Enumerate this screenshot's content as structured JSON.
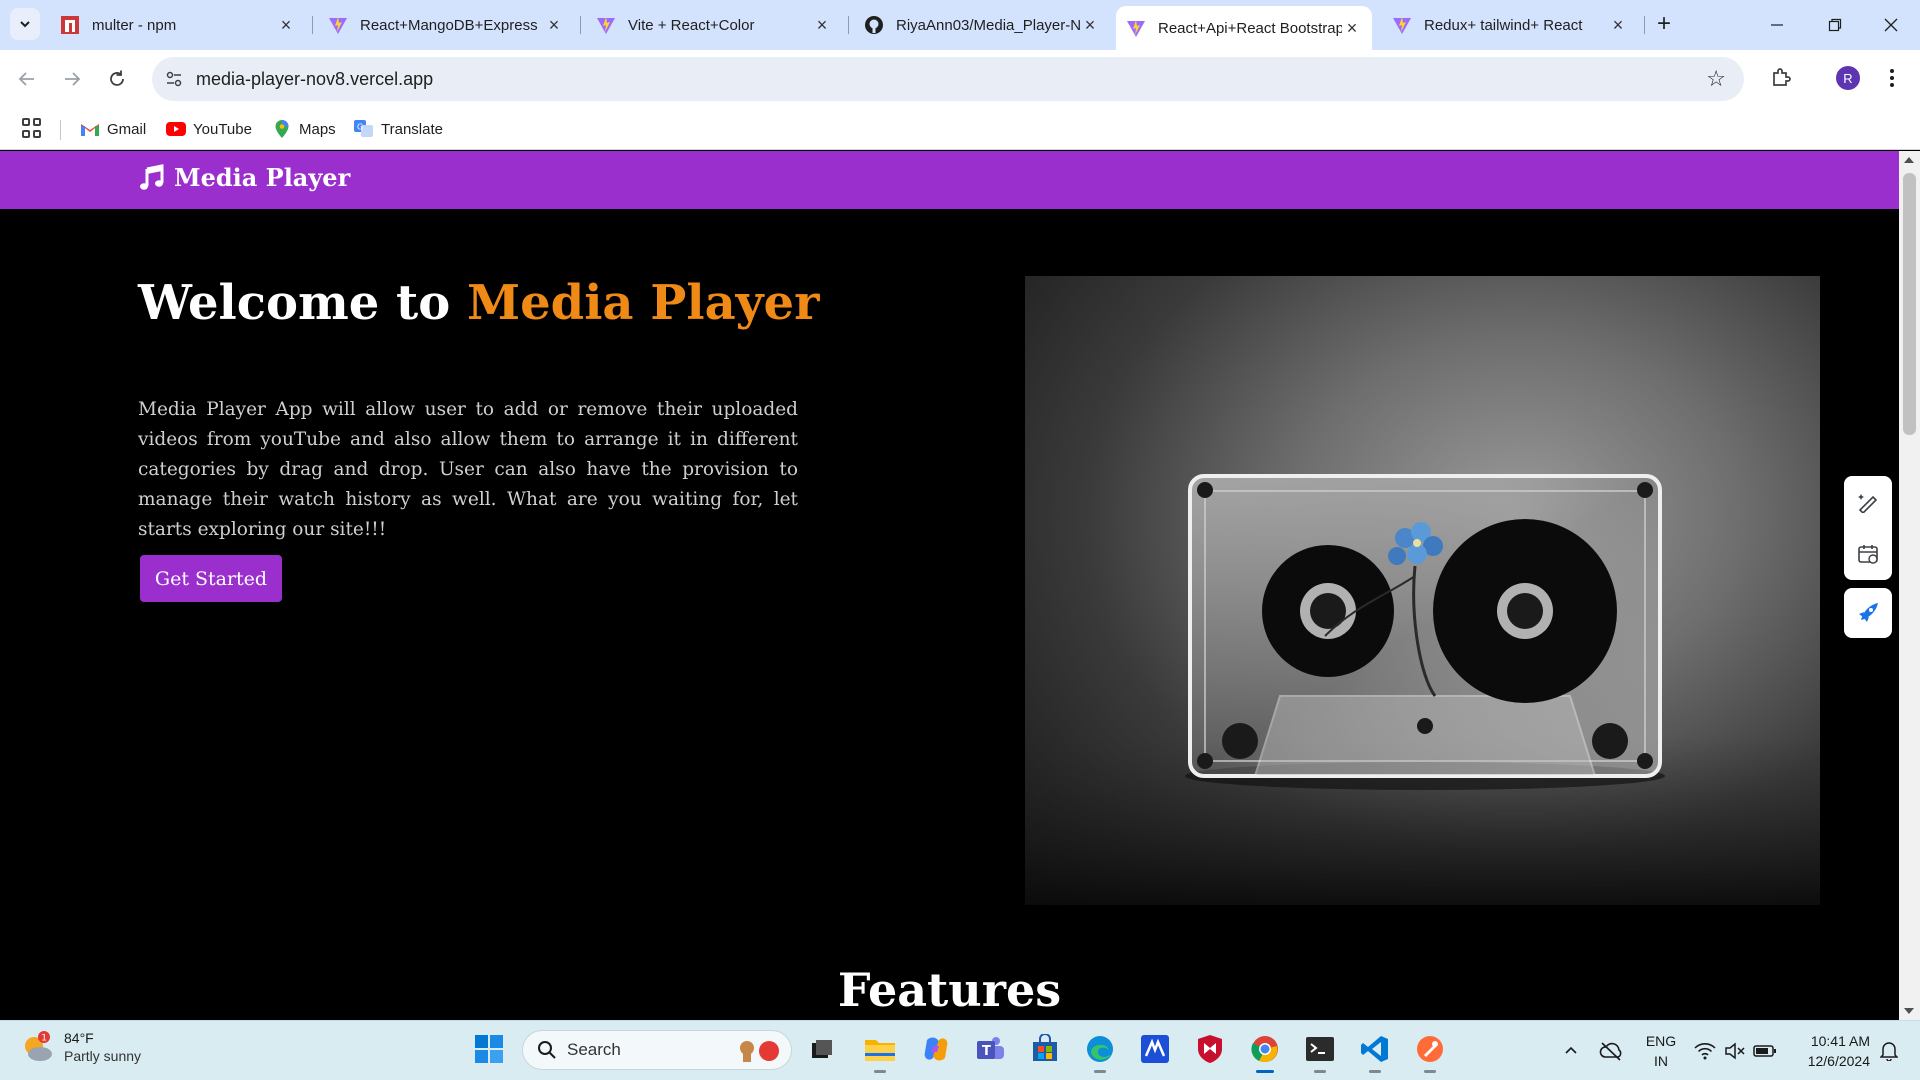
{
  "browser": {
    "tabs": [
      {
        "title": "multer - npm",
        "icon": "npm-icon",
        "active": false
      },
      {
        "title": "React+MangoDB+Express",
        "icon": "vite-icon",
        "active": false
      },
      {
        "title": "Vite + React+Color",
        "icon": "vite-icon",
        "active": false
      },
      {
        "title": "RiyaAnn03/Media_Player-N",
        "icon": "github-icon",
        "active": false
      },
      {
        "title": "React+Api+React Bootstrap",
        "icon": "vite-icon",
        "active": true
      },
      {
        "title": "Redux+ tailwind+ React",
        "icon": "vite-icon",
        "active": false
      }
    ],
    "url": "media-player-nov8.vercel.app",
    "profile_initial": "R",
    "bookmarks": [
      {
        "label": "Gmail",
        "icon": "gmail-icon"
      },
      {
        "label": "YouTube",
        "icon": "youtube-icon"
      },
      {
        "label": "Maps",
        "icon": "maps-icon"
      },
      {
        "label": "Translate",
        "icon": "translate-icon"
      }
    ]
  },
  "page": {
    "brand": "Media Player",
    "hero": {
      "title_prefix": "Welcome to ",
      "title_accent": "Media Player",
      "description": "Media Player App will allow user to add or remove their uploaded videos from youTube and also allow them to arrange it in different categories by drag and drop. User can also have the provision to manage their watch history as well. What are you waiting for, let starts exploring our site!!!",
      "cta_label": "Get Started",
      "image_subject": "cassette-tape-with-blue-flower"
    },
    "features_title": "Features"
  },
  "taskbar": {
    "weather": {
      "temp": "84°F",
      "condition": "Partly sunny",
      "badge": "1"
    },
    "search_label": "Search",
    "language": {
      "line1": "ENG",
      "line2": "IN"
    },
    "clock": {
      "time": "10:41 AM",
      "date": "12/6/2024"
    }
  },
  "colors": {
    "navbar": "#9b2fce",
    "accent": "#f08a16",
    "button": "#9b2fce"
  }
}
